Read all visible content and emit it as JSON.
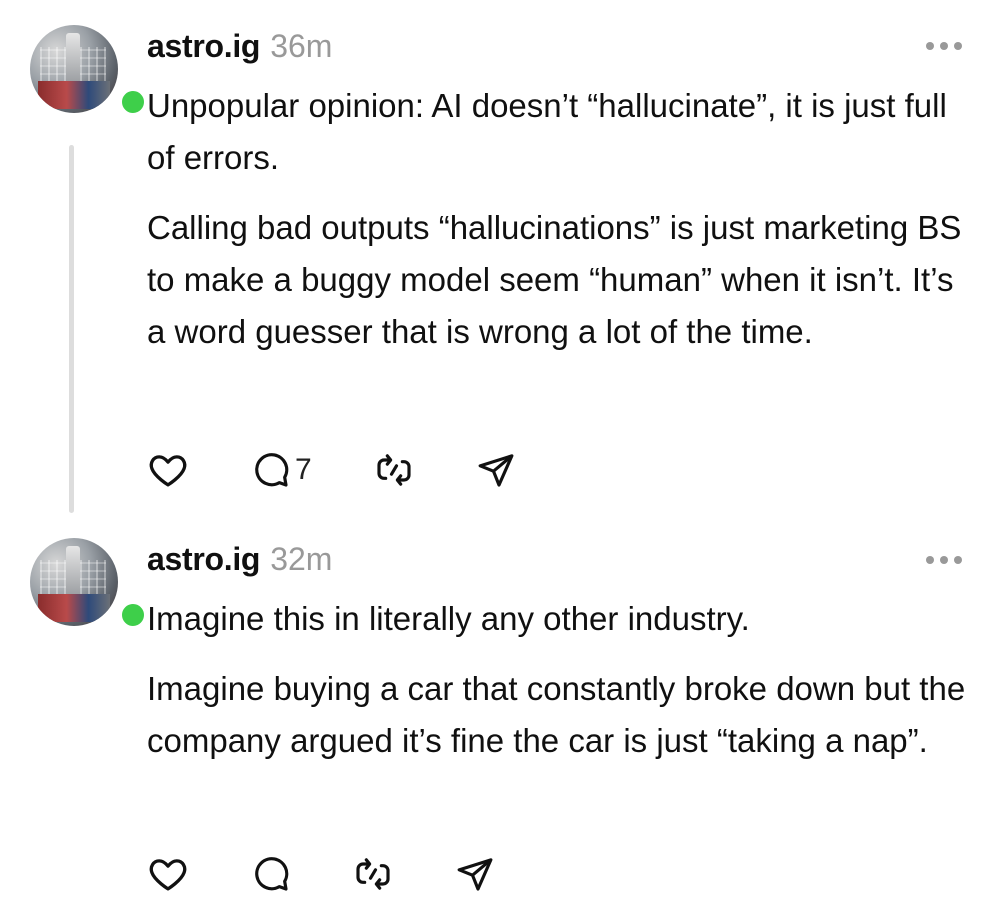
{
  "posts": [
    {
      "username": "astro.ig",
      "time": "36m",
      "paragraphs": [
        "Unpopular opinion: AI doesn’t “hallucinate”, it is just full of errors.",
        "Calling bad outputs “hallucinations” is just marketing BS to make a buggy model seem “human” when it isn’t. It’s a word guesser that is wrong a lot of the time."
      ],
      "reply_count": "7",
      "online_color": "#3ecf4a"
    },
    {
      "username": "astro.ig",
      "time": "32m",
      "paragraphs": [
        "Imagine this in literally any other industry.",
        "Imagine buying a car that constantly broke down but the company argued it’s fine the car is just “taking a nap”."
      ],
      "reply_count": "",
      "online_color": "#3ecf4a"
    }
  ],
  "icons": [
    "heart-icon",
    "comment-icon",
    "repost-icon",
    "share-icon",
    "more-icon"
  ]
}
